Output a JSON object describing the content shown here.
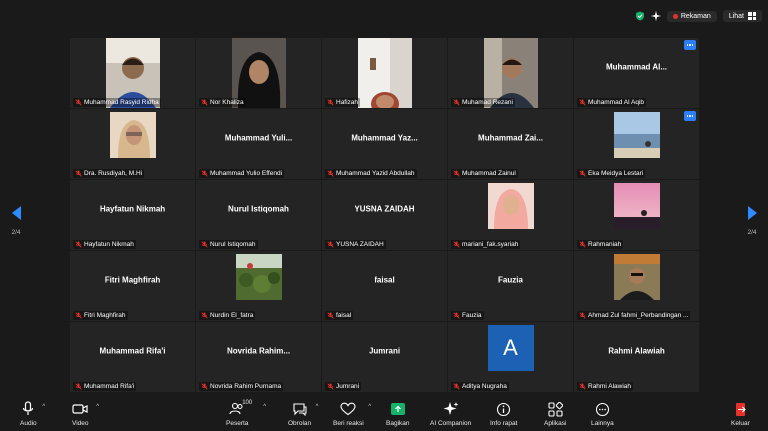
{
  "status": {
    "recording": "Rekaman",
    "view": "Lihat"
  },
  "pager": {
    "left": "2/4",
    "right": "2/4"
  },
  "participants": [
    {
      "name": "Muhammad Rasyid Ridha",
      "display": "",
      "video": "rasyid"
    },
    {
      "name": "Nor Khaliza",
      "display": "",
      "video": "khaliza"
    },
    {
      "name": "Hafizah",
      "display": "",
      "video": "hafizah"
    },
    {
      "name": "Muhamad Rezani",
      "display": "",
      "video": "rezani"
    },
    {
      "name": "Muhammad Al Aqib",
      "display": "Muhammad Al...",
      "video": "",
      "more": true
    },
    {
      "name": "Dra. Rusdiyah, M.Hi",
      "display": "",
      "video": "rusdiyah"
    },
    {
      "name": "Muhammad Yulio Effendi",
      "display": "Muhammad Yuli...",
      "video": ""
    },
    {
      "name": "Muhammad Yazid Abdullah",
      "display": "Muhammad Yaz...",
      "video": ""
    },
    {
      "name": "Muhammad Zainul",
      "display": "Muhammad Zai...",
      "video": ""
    },
    {
      "name": "Eka Meidya Lestari",
      "display": "",
      "video": "eka",
      "more": true
    },
    {
      "name": "Hayfatun Nikmah",
      "display": "Hayfatun Nikmah",
      "video": ""
    },
    {
      "name": "Nurul Istiqomah",
      "display": "Nurul Istiqomah",
      "video": ""
    },
    {
      "name": "YUSNA ZAIDAH",
      "display": "YUSNA ZAIDAH",
      "video": ""
    },
    {
      "name": "mariani_fak.syariah",
      "display": "",
      "video": "mariani"
    },
    {
      "name": "Rahmaniah",
      "display": "",
      "video": "rahmaniah"
    },
    {
      "name": "Fitri Maghfirah",
      "display": "Fitri Maghfirah",
      "video": ""
    },
    {
      "name": "Nurdin El_fatra",
      "display": "",
      "video": "nurdin"
    },
    {
      "name": "faisal",
      "display": "faisal",
      "video": ""
    },
    {
      "name": "Fauzia",
      "display": "Fauzia",
      "video": ""
    },
    {
      "name": "Ahmad Zul fahmi_Perbandingan ...",
      "display": "",
      "video": "ahmad"
    },
    {
      "name": "Muhammad Rifa'i",
      "display": "Muhammad Rifa'i",
      "video": ""
    },
    {
      "name": "Novrida Rahim Purnama",
      "display": "Novrida  Rahim...",
      "video": ""
    },
    {
      "name": "Jumrani",
      "display": "Jumrani",
      "video": ""
    },
    {
      "name": "Aditya Nugraha",
      "display": "",
      "video": "",
      "avatar": "A"
    },
    {
      "name": "Rahmi Alawiah",
      "display": "Rahmi Alawiah",
      "video": ""
    }
  ],
  "toolbar": {
    "audio": "Audio",
    "video": "Video",
    "participants": "Peserta",
    "participants_count": "100",
    "chat": "Obrolan",
    "reactions": "Beri reaksi",
    "share": "Bagikan",
    "ai": "AI Companion",
    "info": "Info rapat",
    "apps": "Aplikasi",
    "more": "Lainnya",
    "leave": "Keluar"
  },
  "colors": {
    "accent": "#2d8cff",
    "share": "#17b26a",
    "record": "#e5322d",
    "avatar": "#1c61b4",
    "leave": "#e5322d"
  }
}
